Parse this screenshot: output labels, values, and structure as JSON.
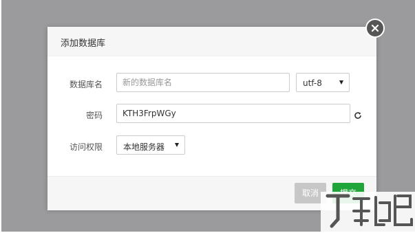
{
  "dialog": {
    "title": "添加数据库",
    "close_icon": "close-icon"
  },
  "form": {
    "db_name": {
      "label": "数据库名",
      "placeholder": "新的数据库名",
      "value": ""
    },
    "charset": {
      "selected": "utf-8"
    },
    "password": {
      "label": "密码",
      "value": "KTH3FrpWGy",
      "refresh_icon": "refresh-icon"
    },
    "access": {
      "label": "访问权限",
      "selected": "本地服务器"
    }
  },
  "footer": {
    "cancel_label": "取消",
    "submit_label": "提交"
  },
  "colors": {
    "overlay": "#9b9b9d",
    "submit": "#20a53a",
    "cancel": "#c7c7c7",
    "close": "#565656"
  }
}
